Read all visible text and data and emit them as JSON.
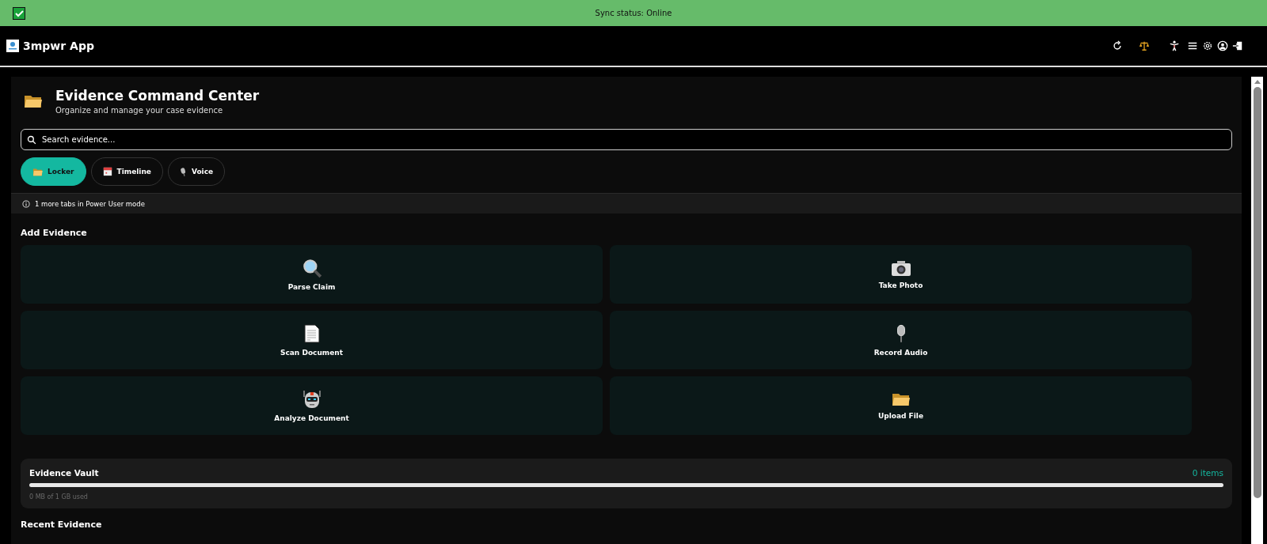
{
  "sync_bar": {
    "checked": true,
    "text": "Sync status: Online"
  },
  "header": {
    "title": "3mpwr App"
  },
  "page": {
    "title": "Evidence Command Center",
    "subtitle": "Organize and manage your case evidence"
  },
  "search": {
    "placeholder": "Search evidence..."
  },
  "tabs": [
    {
      "label": "Locker",
      "selected": true
    },
    {
      "label": "Timeline",
      "selected": false
    },
    {
      "label": "Voice",
      "selected": false
    }
  ],
  "notice": "1 more tabs in Power User mode",
  "add_evidence": {
    "title": "Add Evidence",
    "actions": [
      "Parse Claim",
      "Take Photo",
      "Scan Document",
      "Record Audio",
      "Analyze Document",
      "Upload File"
    ]
  },
  "vault": {
    "title": "Evidence Vault",
    "count": "0 items",
    "level": 0,
    "usage": "0 MB of 1 GB used"
  },
  "recent": {
    "title": "Recent Evidence"
  }
}
